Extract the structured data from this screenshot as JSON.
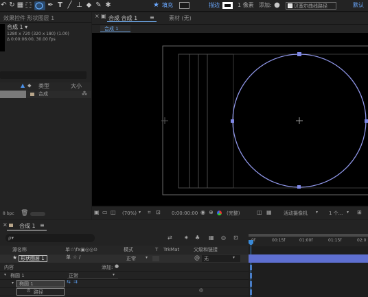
{
  "colors": {
    "accent_blue": "#3a8ad8",
    "fill_swatch": "#1a1a1a",
    "stroke_swatch": "#ffffff",
    "shape_stroke": "#7f88e6",
    "track_bar": "#5e6fd0",
    "tab_highlight": "#6da7e8"
  },
  "toolbar": {
    "icons": [
      "undo-icon",
      "rotate-icon",
      "grid-icon",
      "ellipse-tool-icon",
      "pen-tool-icon",
      "text-tool-icon",
      "brush-tool-icon",
      "stamp-tool-icon",
      "eraser-tool-icon",
      "roto-tool-icon",
      "pin-tool-icon"
    ],
    "star_icon": "★",
    "fill_label": "填充",
    "stroke_label": "描边",
    "stroke_width": "1 像素",
    "add_label": "添加:",
    "bezier_label": "贝塞尔曲线路径",
    "default_label": "默认"
  },
  "project": {
    "tab_label": "效果控件 形状图层 1",
    "comp_name": "合成 1 ▾",
    "comp_info_1": "1280 x 720 (320 x 180) (1.00)",
    "comp_info_2": "Δ 0:00:06:00, 30.00 fps",
    "col_type": "类型",
    "col_size": "大小",
    "item_type": "合成",
    "bpc": "8 bpc"
  },
  "viewer": {
    "tab_label": "合成 合成 1",
    "tab_menu": "≡",
    "footage_label": "素材 (无)",
    "breadcrumb": "合成 1",
    "zoom": "(70%)",
    "timecode": "0:00:00:00",
    "quality": "(完整)",
    "camera": "活动摄像机",
    "views": "1 个..."
  },
  "timeline": {
    "tab_label": "合成 1",
    "tab_menu": "≡",
    "search_placeholder": "ρ▾",
    "col_source": "源名称",
    "col_switches": "单☆\\fx▣◎◎⊙",
    "col_mode": "模式",
    "col_t": "T",
    "col_trkmat": "TrkMat",
    "col_parent": "父级和链接",
    "layer_name": "形状图层 1",
    "layer_mode": "正常",
    "parent_value": "无",
    "contents_label": "内容",
    "add_label": "添加:",
    "ellipse_group": "椭圆 1",
    "ellipse_mode": "正常",
    "ellipse_path": "椭圆 1",
    "path_label": "路径",
    "ruler_ticks": [
      "0f",
      "00:15f",
      "01:00f",
      "01:15f",
      "02:0"
    ]
  }
}
